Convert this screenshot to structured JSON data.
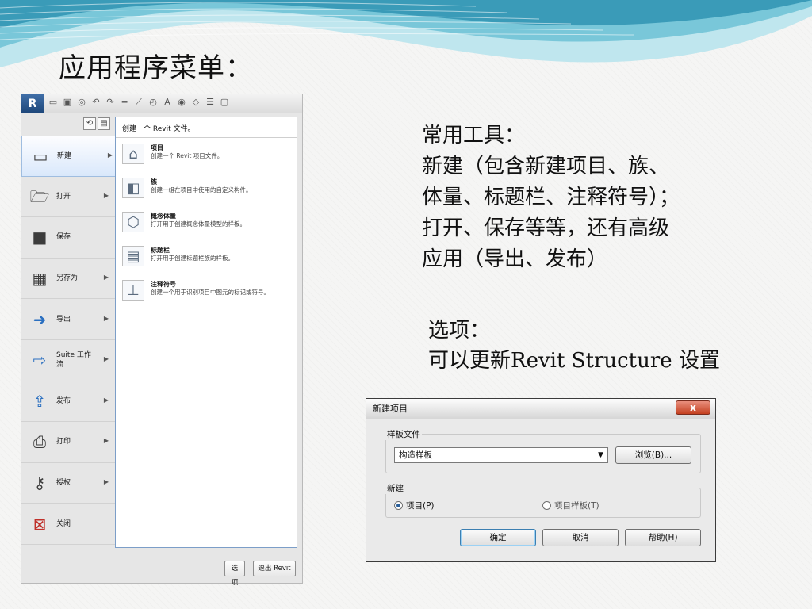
{
  "slide": {
    "title": "应用程序菜单："
  },
  "revit_menu": {
    "app_button": "R",
    "flyout_header": "创建一个 Revit 文件。",
    "items": [
      {
        "label": "新建",
        "icon": "new-file-icon",
        "has_submenu": true,
        "active": true
      },
      {
        "label": "打开",
        "icon": "open-folder-icon",
        "has_submenu": true
      },
      {
        "label": "保存",
        "icon": "save-icon",
        "has_submenu": false
      },
      {
        "label": "另存为",
        "icon": "save-as-icon",
        "has_submenu": true
      },
      {
        "label": "导出",
        "icon": "export-icon",
        "has_submenu": true
      },
      {
        "label": "Suite 工作流",
        "icon": "suite-workflow-icon",
        "has_submenu": true
      },
      {
        "label": "发布",
        "icon": "publish-icon",
        "has_submenu": true
      },
      {
        "label": "打印",
        "icon": "print-icon",
        "has_submenu": true
      },
      {
        "label": "授权",
        "icon": "license-key-icon",
        "has_submenu": true
      },
      {
        "label": "关闭",
        "icon": "close-file-icon",
        "has_submenu": false
      }
    ],
    "submenu": [
      {
        "title": "项目",
        "desc": "创建一个 Revit 项目文件。",
        "icon": "project-icon"
      },
      {
        "title": "族",
        "desc": "创建一组在项目中使用的自定义构件。",
        "icon": "family-icon"
      },
      {
        "title": "概念体量",
        "desc": "打开用于创建概念体量模型的样板。",
        "icon": "conceptual-mass-icon"
      },
      {
        "title": "标题栏",
        "desc": "打开用于创建标题栏族的样板。",
        "icon": "title-block-icon"
      },
      {
        "title": "注释符号",
        "desc": "创建一个用于识别项目中图元的标记或符号。",
        "icon": "annotation-symbol-icon"
      }
    ],
    "options_button": "选项",
    "exit_button": "退出 Revit"
  },
  "notes": {
    "common_tools": {
      "line1": "常用工具：",
      "line2": "新建（包含新建项目、族、",
      "line3": "体量、标题栏、注释符号）；",
      "line4": "打开、保存等等，还有高级",
      "line5": "应用（导出、发布）"
    },
    "options": {
      "line1": "选项：",
      "line2": "可以更新Revit Structure 设置"
    }
  },
  "dialog": {
    "title": "新建项目",
    "close_label": "x",
    "template_group_label": "样板文件",
    "template_value": "构造样板",
    "browse_button": "浏览(B)...",
    "new_group_label": "新建",
    "radio_project": "项目(P)",
    "radio_template": "项目样板(T)",
    "ok_button": "确定",
    "cancel_button": "取消",
    "help_button": "帮助(H)"
  },
  "colors": {
    "wave_dark": "#3a9bb8",
    "wave_light": "#a7dde8",
    "flyout_border": "#7c9ec8",
    "dialog_close": "#c4401f"
  }
}
